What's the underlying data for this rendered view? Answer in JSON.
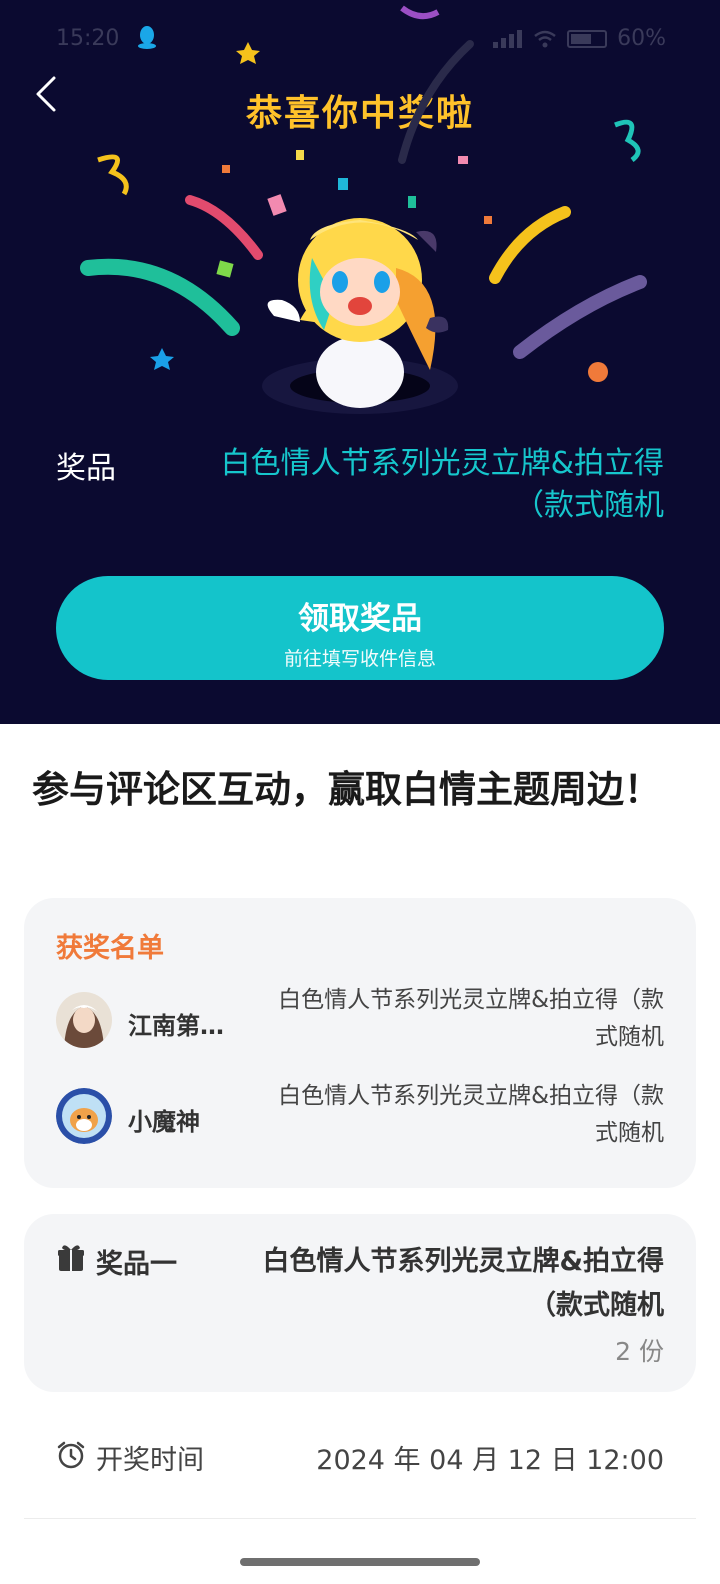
{
  "status_bar": {
    "time": "15:20",
    "battery": "60%"
  },
  "header": {
    "title": "恭喜你中奖啦"
  },
  "prize": {
    "label": "奖品",
    "value": "白色情人节系列光灵立牌&拍立得（款式随机"
  },
  "claim_button": {
    "label": "领取奖品",
    "sub_label": "前往填写收件信息"
  },
  "activity_title": "参与评论区互动，赢取白情主题周边！",
  "winners": {
    "heading": "获奖名单",
    "list": [
      {
        "name": "江南第…",
        "prize": "白色情人节系列光灵立牌&拍立得（款式随机"
      },
      {
        "name": "小魔神",
        "prize": "白色情人节系列光灵立牌&拍立得（款式随机"
      }
    ]
  },
  "prize_item": {
    "label": "奖品一",
    "value": "白色情人节系列光灵立牌&拍立得（款式随机",
    "count": "2 份"
  },
  "draw_time": {
    "label": "开奖时间",
    "value": "2024 年 04 月 12 日 12:00"
  },
  "colors": {
    "hero_bg": "#0b0a30",
    "title": "#ffc22a",
    "accent": "#14c4cb",
    "winners_heading": "#f07a3a"
  }
}
